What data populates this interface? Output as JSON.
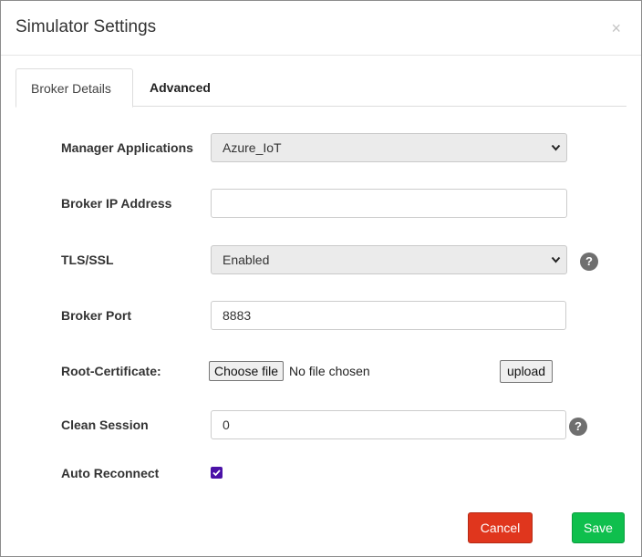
{
  "dialog": {
    "title": "Simulator Settings",
    "close_glyph": "×"
  },
  "tabs": [
    {
      "label": "Broker Details",
      "active": true
    },
    {
      "label": "Advanced",
      "active": false
    }
  ],
  "form": {
    "manager_applications": {
      "label": "Manager Applications",
      "value": "Azure_IoT"
    },
    "broker_ip": {
      "label": "Broker IP Address",
      "value": ""
    },
    "tls_ssl": {
      "label": "TLS/SSL",
      "value": "Enabled"
    },
    "broker_port": {
      "label": "Broker Port",
      "value": "8883"
    },
    "root_certificate": {
      "label": "Root-Certificate:",
      "choose_file_label": "Choose file",
      "file_status": "No file chosen",
      "upload_label": "upload"
    },
    "clean_session": {
      "label": "Clean Session",
      "value": "0"
    },
    "auto_reconnect": {
      "label": "Auto Reconnect",
      "checked": true
    },
    "help_glyph": "?"
  },
  "footer": {
    "cancel_label": "Cancel",
    "save_label": "Save"
  },
  "colors": {
    "cancel": "#e0361d",
    "save": "#0fbf4d",
    "checkbox": "#4b12a7"
  },
  "icons": {
    "close": "close-icon",
    "help": "help-icon",
    "dropdown": "chevron-down-icon",
    "check": "checkmark-icon"
  }
}
